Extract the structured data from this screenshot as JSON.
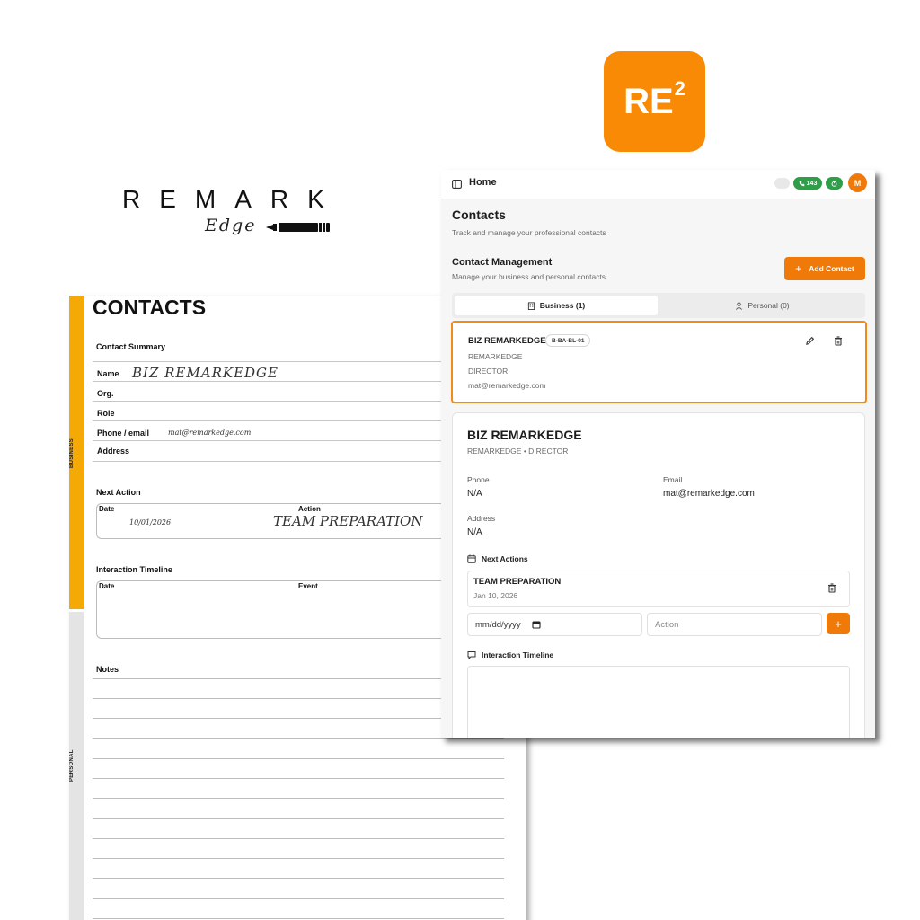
{
  "badge": {
    "text": "RE",
    "sup": "2"
  },
  "brand": {
    "word": "REMARK",
    "script": "Edge"
  },
  "paper": {
    "title": "CONTACTS",
    "tab_business": "BUSINESS",
    "tab_personal": "PERSONAL",
    "summary_label": "Contact Summary",
    "fields": {
      "name_label": "Name",
      "name_value": "BIZ REMARKEDGE",
      "org_label": "Org.",
      "role_label": "Role",
      "phone_label": "Phone / email",
      "phone_value": "mat@remarkedge.com",
      "address_label": "Address"
    },
    "next_action_label": "Next Action",
    "next_action_date_header": "Date",
    "next_action_action_header": "Action",
    "next_action_date_value": "10/01/2026",
    "next_action_action_value": "TEAM PREPARATION",
    "timeline_label": "Interaction Timeline",
    "timeline_date_header": "Date",
    "timeline_event_header": "Event",
    "notes_label": "Notes"
  },
  "app": {
    "breadcrumb": "Home",
    "credits": "143",
    "avatar": "M",
    "page_title": "Contacts",
    "page_subtitle": "Track and manage your professional contacts",
    "mgmt_title": "Contact Management",
    "mgmt_subtitle": "Manage your business and personal contacts",
    "add_button": "Add Contact",
    "tabs": {
      "business": "Business (1)",
      "personal": "Personal (0)"
    },
    "card": {
      "name": "BIZ REMARKEDGE",
      "code": "B-BA-BL-01",
      "org": "REMARKEDGE",
      "role": "DIRECTOR",
      "email": "mat@remarkedge.com"
    },
    "detail": {
      "name": "BIZ REMARKEDGE",
      "subtitle": "REMARKEDGE • DIRECTOR",
      "phone_label": "Phone",
      "phone_value": "N/A",
      "email_label": "Email",
      "email_value": "mat@remarkedge.com",
      "address_label": "Address",
      "address_value": "N/A",
      "next_actions_label": "Next Actions",
      "action_title": "TEAM PREPARATION",
      "action_date": "Jan 10, 2026",
      "date_placeholder": "mm/dd/yyyy",
      "action_placeholder": "Action",
      "timeline_label": "Interaction Timeline"
    },
    "colors": {
      "accent": "#ef7a0a",
      "green": "#2e9e48",
      "tab_yellow": "#f5a905"
    }
  }
}
